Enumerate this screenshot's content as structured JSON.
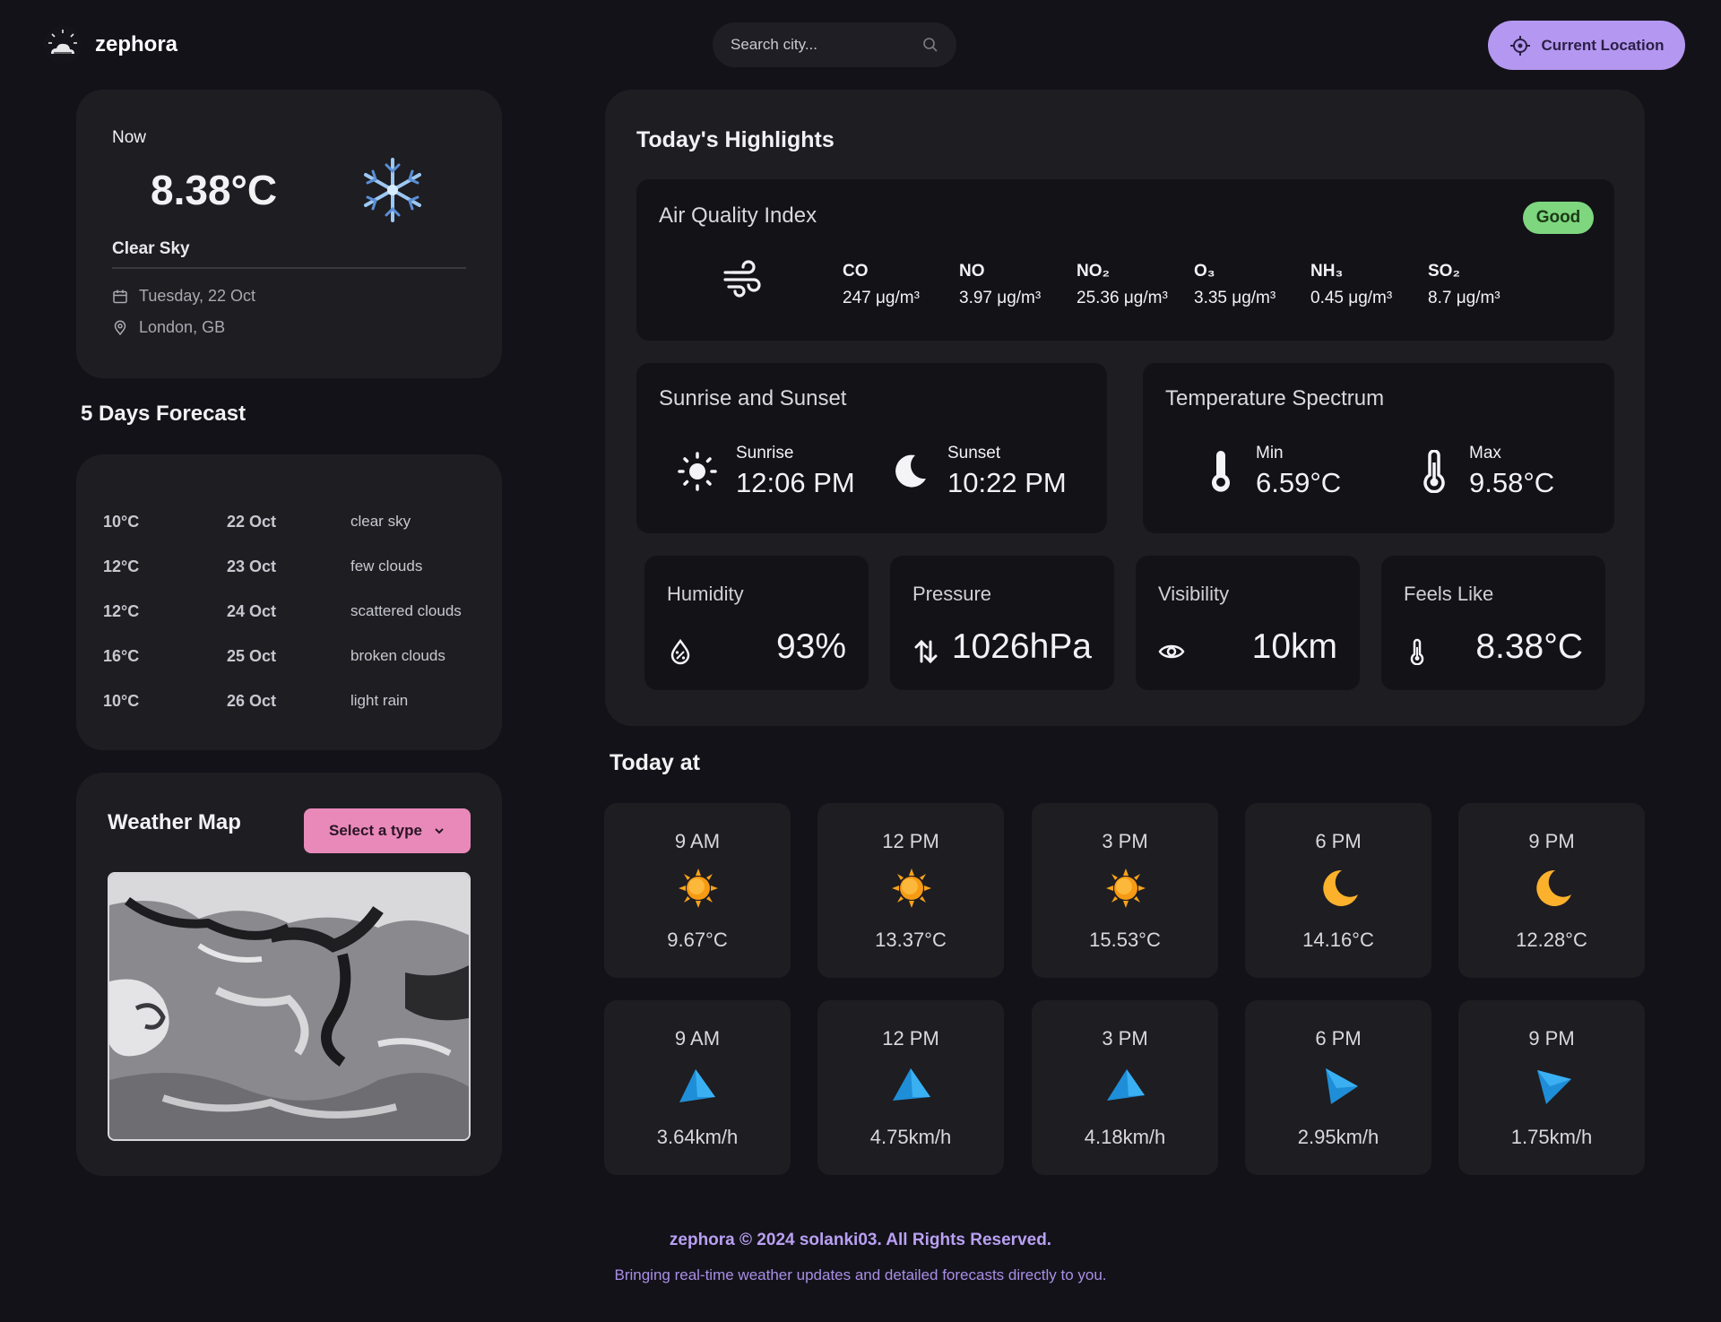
{
  "app": {
    "name": "zephora"
  },
  "search": {
    "placeholder": "Search city..."
  },
  "location_button": {
    "label": "Current Location"
  },
  "now": {
    "label": "Now",
    "temp": "8.38°C",
    "icon": "snowflake-icon",
    "description": "Clear Sky",
    "date": "Tuesday, 22 Oct",
    "location": "London, GB"
  },
  "forecast": {
    "title": "5 Days Forecast",
    "days": [
      {
        "temp": "10°C",
        "date": "22 Oct",
        "desc": "clear sky"
      },
      {
        "temp": "12°C",
        "date": "23 Oct",
        "desc": "few clouds"
      },
      {
        "temp": "12°C",
        "date": "24 Oct",
        "desc": "scattered clouds"
      },
      {
        "temp": "16°C",
        "date": "25 Oct",
        "desc": "broken clouds"
      },
      {
        "temp": "10°C",
        "date": "26 Oct",
        "desc": "light rain"
      }
    ]
  },
  "map": {
    "title": "Weather Map",
    "select_label": "Select a type"
  },
  "highlights": {
    "title": "Today's Highlights",
    "aqi": {
      "title": "Air Quality Index",
      "badge": "Good",
      "items": [
        {
          "key": "CO",
          "value": "247 μg/m³"
        },
        {
          "key": "NO",
          "value": "3.97 μg/m³"
        },
        {
          "key": "NO₂",
          "value": "25.36 μg/m³"
        },
        {
          "key": "O₃",
          "value": "3.35 μg/m³"
        },
        {
          "key": "NH₃",
          "value": "0.45 μg/m³"
        },
        {
          "key": "SO₂",
          "value": "8.7 μg/m³"
        }
      ]
    },
    "sun": {
      "title": "Sunrise and Sunset",
      "sunrise_label": "Sunrise",
      "sunrise": "12:06 PM",
      "sunset_label": "Sunset",
      "sunset": "10:22 PM"
    },
    "temp_spectrum": {
      "title": "Temperature Spectrum",
      "min_label": "Min",
      "min": "6.59°C",
      "max_label": "Max",
      "max": "9.58°C"
    },
    "humidity": {
      "title": "Humidity",
      "value": "93%"
    },
    "pressure": {
      "title": "Pressure",
      "value": "1026hPa"
    },
    "visibility": {
      "title": "Visibility",
      "value": "10km"
    },
    "feels_like": {
      "title": "Feels Like",
      "value": "8.38°C"
    }
  },
  "today": {
    "title": "Today at",
    "temps": [
      {
        "hour": "9 AM",
        "value": "9.67°C",
        "icon": "sun-icon"
      },
      {
        "hour": "12 PM",
        "value": "13.37°C",
        "icon": "sun-icon"
      },
      {
        "hour": "3 PM",
        "value": "15.53°C",
        "icon": "sun-icon"
      },
      {
        "hour": "6 PM",
        "value": "14.16°C",
        "icon": "moon-icon"
      },
      {
        "hour": "9 PM",
        "value": "12.28°C",
        "icon": "moon-icon"
      }
    ],
    "winds": [
      {
        "hour": "9 AM",
        "value": "3.64km/h",
        "icon": "wind-direction-icon"
      },
      {
        "hour": "12 PM",
        "value": "4.75km/h",
        "icon": "wind-direction-icon"
      },
      {
        "hour": "3 PM",
        "value": "4.18km/h",
        "icon": "wind-direction-icon"
      },
      {
        "hour": "6 PM",
        "value": "2.95km/h",
        "icon": "wind-direction-icon"
      },
      {
        "hour": "9 PM",
        "value": "1.75km/h",
        "icon": "wind-direction-icon"
      }
    ]
  },
  "footer": {
    "copyright": "zephora © 2024  solanki03. All Rights Reserved.",
    "tagline": "Bringing real-time weather updates and detailed forecasts directly to you."
  },
  "colors": {
    "accent": "#b497f0",
    "select_button": "#e889b9",
    "good_badge": "#7ed67f",
    "card": "#1e1d22",
    "background": "#131219"
  }
}
